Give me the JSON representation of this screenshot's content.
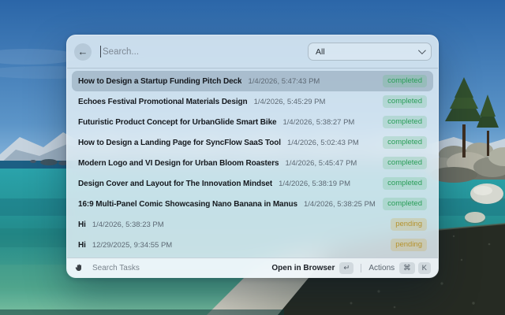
{
  "header": {
    "back_label": "←",
    "search_placeholder": "Search...",
    "filter_value": "All"
  },
  "list": {
    "selected_index": 0
  },
  "tasks": [
    {
      "title": "How to Design a Startup Funding Pitch Deck",
      "time": "1/4/2026, 5:47:43 PM",
      "status": "completed"
    },
    {
      "title": "Echoes Festival Promotional Materials Design",
      "time": "1/4/2026, 5:45:29 PM",
      "status": "completed"
    },
    {
      "title": "Futuristic Product Concept for UrbanGlide Smart Bike",
      "time": "1/4/2026, 5:38:27 PM",
      "status": "completed"
    },
    {
      "title": "How to Design a Landing Page for SyncFlow SaaS Tool",
      "time": "1/4/2026, 5:02:43 PM",
      "status": "completed"
    },
    {
      "title": "Modern Logo and VI Design for Urban Bloom Roasters",
      "time": "1/4/2026, 5:45:47 PM",
      "status": "completed"
    },
    {
      "title": "Design Cover and Layout for The Innovation Mindset",
      "time": "1/4/2026, 5:38:19 PM",
      "status": "completed"
    },
    {
      "title": "16:9 Multi-Panel Comic Showcasing Nano Banana in Manus",
      "time": "1/4/2026, 5:38:25 PM",
      "status": "completed"
    },
    {
      "title": "Hi",
      "time": "1/4/2026, 5:38:23 PM",
      "status": "pending"
    },
    {
      "title": "Hi",
      "time": "12/29/2025, 9:34:55 PM",
      "status": "pending"
    }
  ],
  "footer": {
    "mode_label": "Search Tasks",
    "open_label": "Open in Browser",
    "enter_key": "↵",
    "actions_label": "Actions",
    "cmd_key": "⌘",
    "k_key": "K"
  },
  "colors": {
    "status_completed": "#2a9d58",
    "status_pending": "#b5932f",
    "panel_background": "#e2edf5",
    "selected_row": "#72899b"
  }
}
